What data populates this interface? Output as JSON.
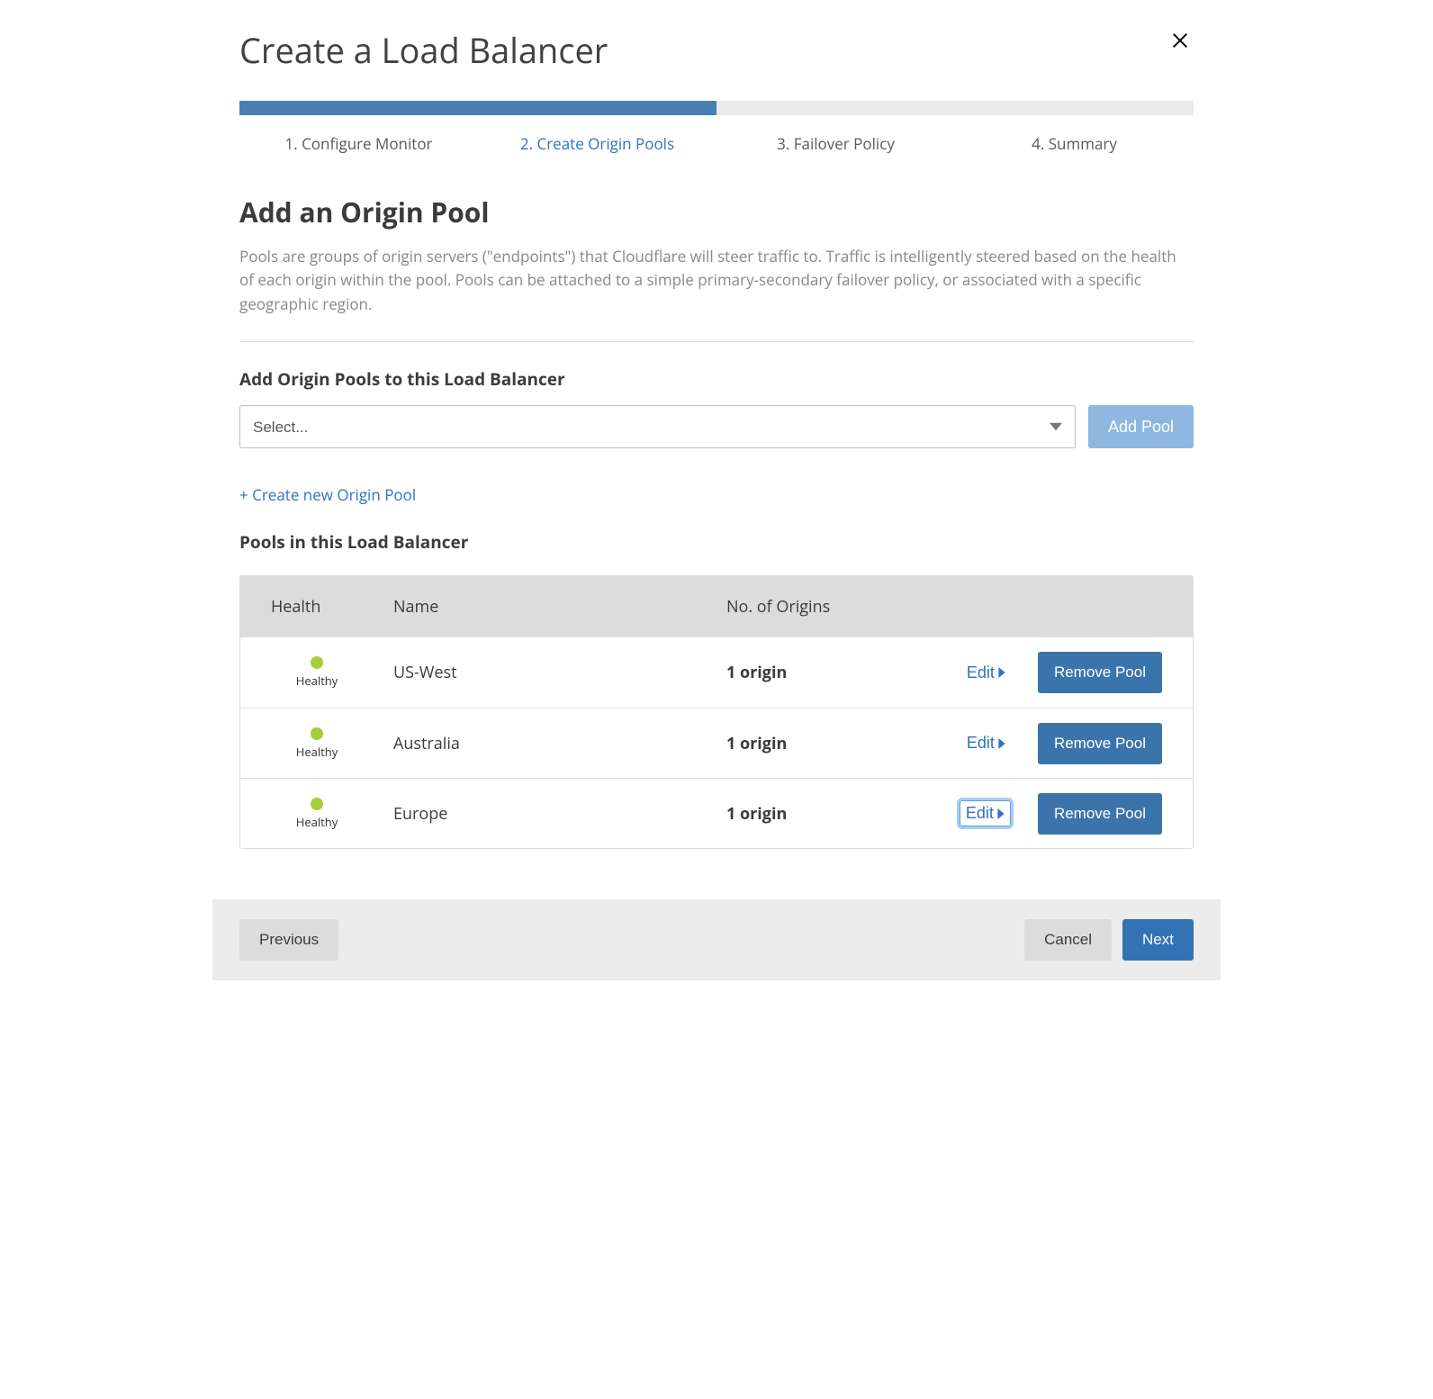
{
  "header": {
    "title": "Create a Load Balancer"
  },
  "steps": {
    "progress_percent": 50,
    "items": [
      {
        "label": "1. Configure Monitor",
        "active": false
      },
      {
        "label": "2. Create Origin Pools",
        "active": true
      },
      {
        "label": "3. Failover Policy",
        "active": false
      },
      {
        "label": "4. Summary",
        "active": false
      }
    ]
  },
  "main": {
    "heading": "Add an Origin Pool",
    "description": "Pools are groups of origin servers (\"endpoints\") that Cloudflare will steer traffic to. Traffic is intelligently steered based on the health of each origin within the pool. Pools can be attached to a simple primary-secondary failover policy, or associated with a specific geographic region.",
    "add_label": "Add Origin Pools to this Load Balancer",
    "select_placeholder": "Select...",
    "add_pool_button": "Add Pool",
    "create_link": "+ Create new Origin Pool",
    "pools_label": "Pools in this Load Balancer",
    "table": {
      "columns": {
        "health": "Health",
        "name": "Name",
        "origins": "No. of Origins"
      },
      "health_status": "Healthy",
      "edit_label": "Edit",
      "remove_label": "Remove Pool",
      "rows": [
        {
          "name": "US-West",
          "origins": "1 origin",
          "focused": false
        },
        {
          "name": "Australia",
          "origins": "1 origin",
          "focused": false
        },
        {
          "name": "Europe",
          "origins": "1 origin",
          "focused": true
        }
      ]
    }
  },
  "footer": {
    "previous": "Previous",
    "cancel": "Cancel",
    "next": "Next"
  }
}
